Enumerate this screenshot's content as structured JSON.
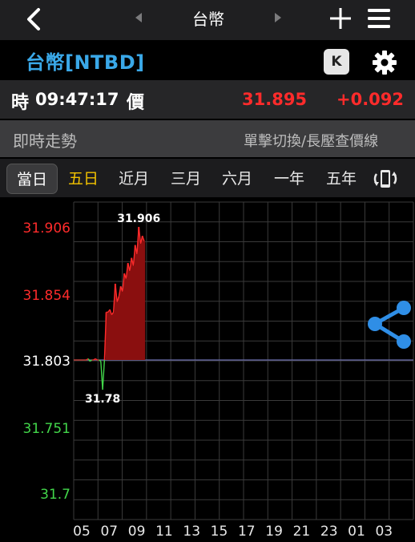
{
  "nav": {
    "title": "台幣"
  },
  "quote": {
    "symbol_title": "台幣[NTBD]",
    "k_label": "K",
    "time_label": "時",
    "time": "09:47:17",
    "price_label": "價",
    "price": "31.895",
    "change": "+0.092"
  },
  "section": {
    "title": "即時走勢",
    "hint": "單擊切換/長壓查價線"
  },
  "tabs": [
    {
      "label": "當日"
    },
    {
      "label": "五日"
    },
    {
      "label": "近月"
    },
    {
      "label": "三月"
    },
    {
      "label": "六月"
    },
    {
      "label": "一年"
    },
    {
      "label": "五年"
    }
  ],
  "colors": {
    "up": "#ff2b2b",
    "down": "#42d64a",
    "neutral": "#ffffff",
    "accent": "#3aa8e8",
    "highlight_tab": "#f2c200",
    "share_icon": "#2f8ee6"
  },
  "chart_data": {
    "type": "line",
    "y_ticks": [
      "31.906",
      "31.854",
      "31.803",
      "31.751",
      "31.7"
    ],
    "y_tick_values": [
      31.906,
      31.854,
      31.803,
      31.751,
      31.7
    ],
    "reference_value": 31.803,
    "ylim": [
      31.7,
      31.906
    ],
    "x_ticks": [
      "05",
      "07",
      "09",
      "11",
      "13",
      "15",
      "17",
      "19",
      "21",
      "23",
      "01",
      "03"
    ],
    "high_label": "31.906",
    "low_label": "31.78",
    "grid": true,
    "series": [
      {
        "values": [
          31.803,
          31.803,
          31.803,
          31.803,
          31.803,
          31.803,
          31.803,
          31.803,
          31.804,
          31.802,
          31.803,
          31.803,
          31.804,
          31.803,
          31.803,
          31.802,
          31.78,
          31.803,
          31.84,
          31.84,
          31.842,
          31.838,
          31.84,
          31.862,
          31.848,
          31.852,
          31.86,
          31.856,
          31.87,
          31.866,
          31.878,
          31.872,
          31.882,
          31.876,
          31.892,
          31.885,
          31.906,
          31.893,
          31.899,
          31.895
        ]
      }
    ]
  }
}
